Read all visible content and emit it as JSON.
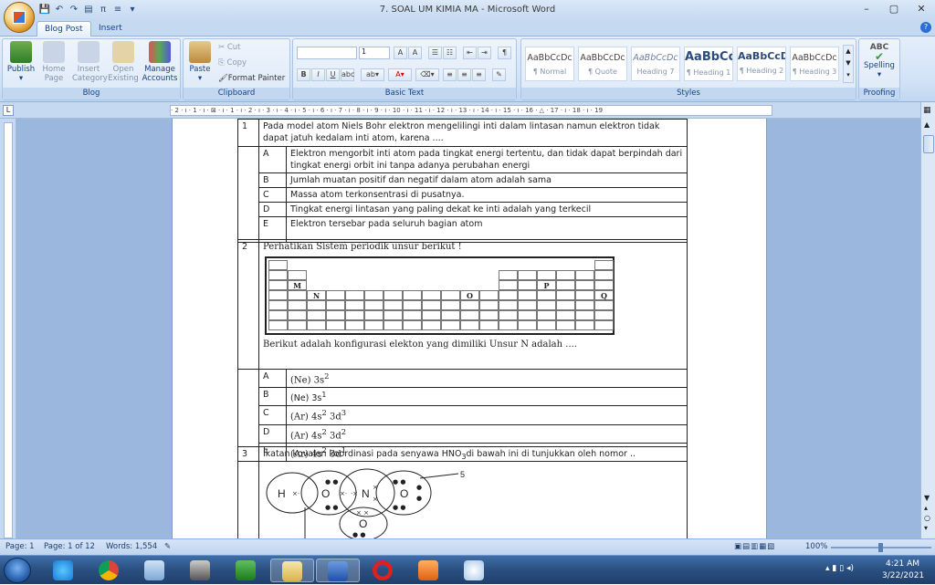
{
  "window": {
    "title": "7. SOAL UM KIMIA MA - Microsoft Word",
    "controls": [
      "–",
      "▢",
      "✕"
    ]
  },
  "tabs": [
    "Blog Post",
    "Insert"
  ],
  "ribbon": {
    "blog": {
      "label": "Blog",
      "publish": "Publish",
      "home_page": "Home Page",
      "insert_category": "Insert Category",
      "open_existing": "Open Existing",
      "manage_accounts": "Manage Accounts"
    },
    "clipboard": {
      "label": "Clipboard",
      "paste": "Paste",
      "cut": "Cut",
      "copy": "Copy",
      "format_painter": "Format Painter"
    },
    "basic_text": {
      "label": "Basic Text",
      "font_size": "1"
    },
    "styles": {
      "label": "Styles",
      "items": [
        {
          "preview": "AaBbCcDc",
          "name": "¶ Normal"
        },
        {
          "preview": "AaBbCcDc",
          "name": "¶ Quote"
        },
        {
          "preview": "AaBbCcDc",
          "name": "Heading 7"
        },
        {
          "preview": "AaBbCc",
          "name": "¶ Heading 1"
        },
        {
          "preview": "AaBbCcD",
          "name": "¶ Heading 2"
        },
        {
          "preview": "AaBbCcDc",
          "name": "¶ Heading 3"
        }
      ]
    },
    "proofing": {
      "label": "Proofing",
      "spelling": "Spelling",
      "abc": "ABC"
    }
  },
  "ruler_text": "· 2 · ı · 1 · ı · ⊠ · ı · 1 · ı · 2 · ı · 3 · ı · 4 · ı · 5 · ı · 6 · ı · 7 · ı · 8 · ı · 9 · ı · 10 · ı · 11 · ı · 12 · ı · 13 · ı · 14 · ı · 15 · ı · 16 · △ · 17 · ı · 18 · ı · 19",
  "doc": {
    "q1": {
      "num": "1",
      "text": "Pada model atom Niels Bohr elektron mengelilingi inti dalam lintasan namun elektron tidak dapat jatuh kedalam inti atom, karena ....",
      "options": [
        {
          "l": "A",
          "t": "Elektron mengorbit inti atom pada tingkat energi tertentu, dan tidak dapat berpindah dari tingkat energi orbit ini tanpa adanya perubahan energi"
        },
        {
          "l": "B",
          "t": "Jumlah muatan positif dan negatif dalam atom adalah sama"
        },
        {
          "l": "C",
          "t": "Massa atom terkonsentrasi di pusatnya."
        },
        {
          "l": "D",
          "t": "Tingkat energi lintasan yang paling dekat ke inti adalah yang terkecil"
        },
        {
          "l": "E",
          "t": "Elektron tersebar pada seluruh bagian atom"
        }
      ]
    },
    "q2": {
      "num": "2",
      "intro": "Perhatikan Sistem periodik unsur berikut !",
      "labels": {
        "M": "M",
        "N": "N",
        "O": "O",
        "P": "P",
        "Q": "Q"
      },
      "question": "Berikut adalah konfigurasi elekton yang dimiliki  Unsur N adalah ....",
      "options": [
        {
          "l": "A",
          "base": "(Ne) 3s",
          "sup": "2",
          "base2": "",
          "sup2": ""
        },
        {
          "l": "B",
          "base": "(Ne) 3s",
          "sup": "1",
          "base2": "",
          "sup2": ""
        },
        {
          "l": "C",
          "base": "(Ar) 4s",
          "sup": "2",
          "base2": " 3d",
          "sup2": "3"
        },
        {
          "l": "D",
          "base": "(Ar) 4s",
          "sup": "2",
          "base2": " 3d",
          "sup2": "2"
        },
        {
          "l": "E",
          "base": "(Ar) 4s",
          "sup": "2",
          "base2": " 3d",
          "sup2": "1"
        }
      ]
    },
    "q3": {
      "num": "3",
      "text_before": "Ikatan kovalen koordinasi pada senyawa HNO",
      "sub": "3",
      "text_after": "di bawah ini di tunjukkan oleh nomor ..",
      "atoms": [
        "H",
        "O",
        "N",
        "O",
        "O"
      ],
      "label_5": "5"
    }
  },
  "status": {
    "page": "Page: 1",
    "page_of": "Page: 1 of 12",
    "words": "Words: 1,554",
    "zoom": "100%"
  },
  "tray": {
    "time": "4:21 AM",
    "date": "3/22/2021"
  }
}
